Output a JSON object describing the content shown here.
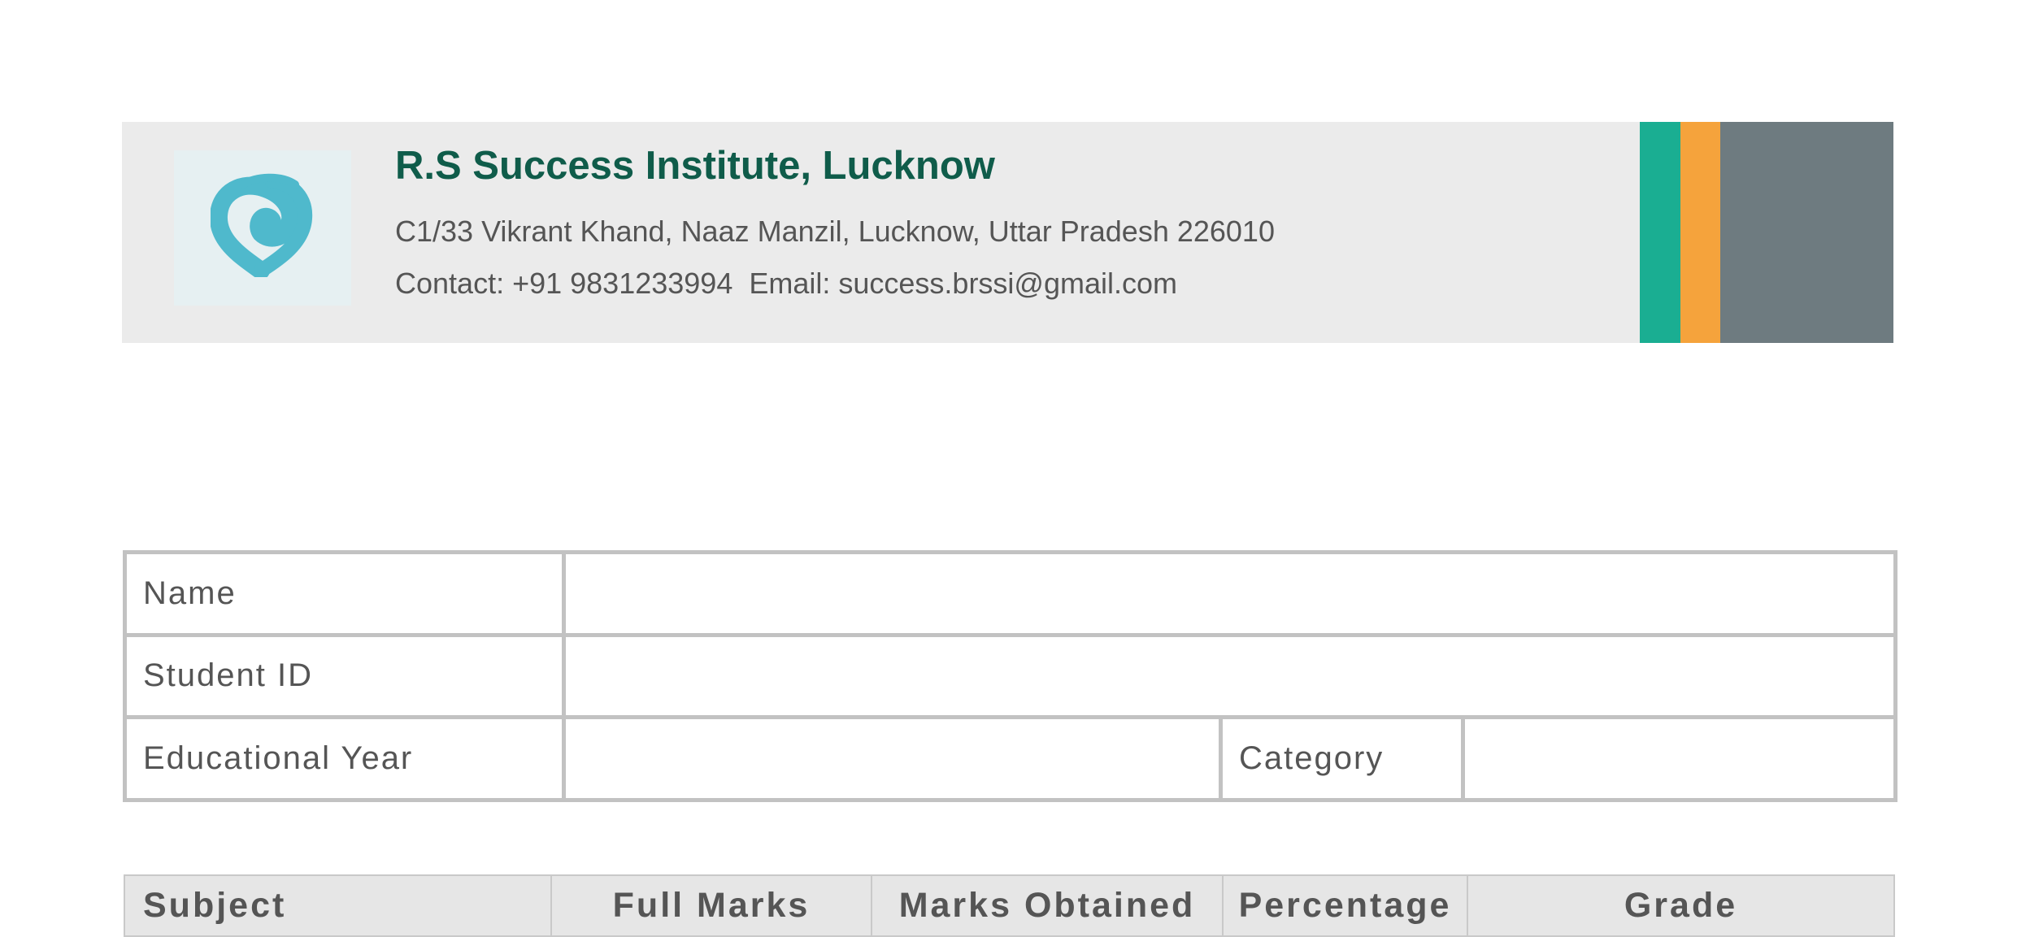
{
  "institute": {
    "name": "R.S Success Institute, Lucknow",
    "address": "C1/33 Vikrant Khand, Naaz Manzil, Lucknow, Uttar Pradesh 226010",
    "contact": "Contact: +91 9831233994  Email: success.brssi@gmail.com",
    "logo_icon": "heart-swirl-logo-icon"
  },
  "colors": {
    "header_bg": "#ebebeb",
    "title": "#0f5c4a",
    "stripe_teal": "#1aae92",
    "stripe_orange": "#f5a33c",
    "stripe_grey": "#6e7b80",
    "logo": "#4fb9cc"
  },
  "student_info": {
    "name_label": "Name",
    "name_value": "",
    "student_id_label": "Student ID",
    "student_id_value": "",
    "educational_year_label": "Educational Year",
    "educational_year_value": "",
    "category_label": "Category",
    "category_value": ""
  },
  "marks_table": {
    "columns": [
      "Subject",
      "Full Marks",
      "Marks Obtained",
      "Percentage",
      "Grade"
    ]
  }
}
